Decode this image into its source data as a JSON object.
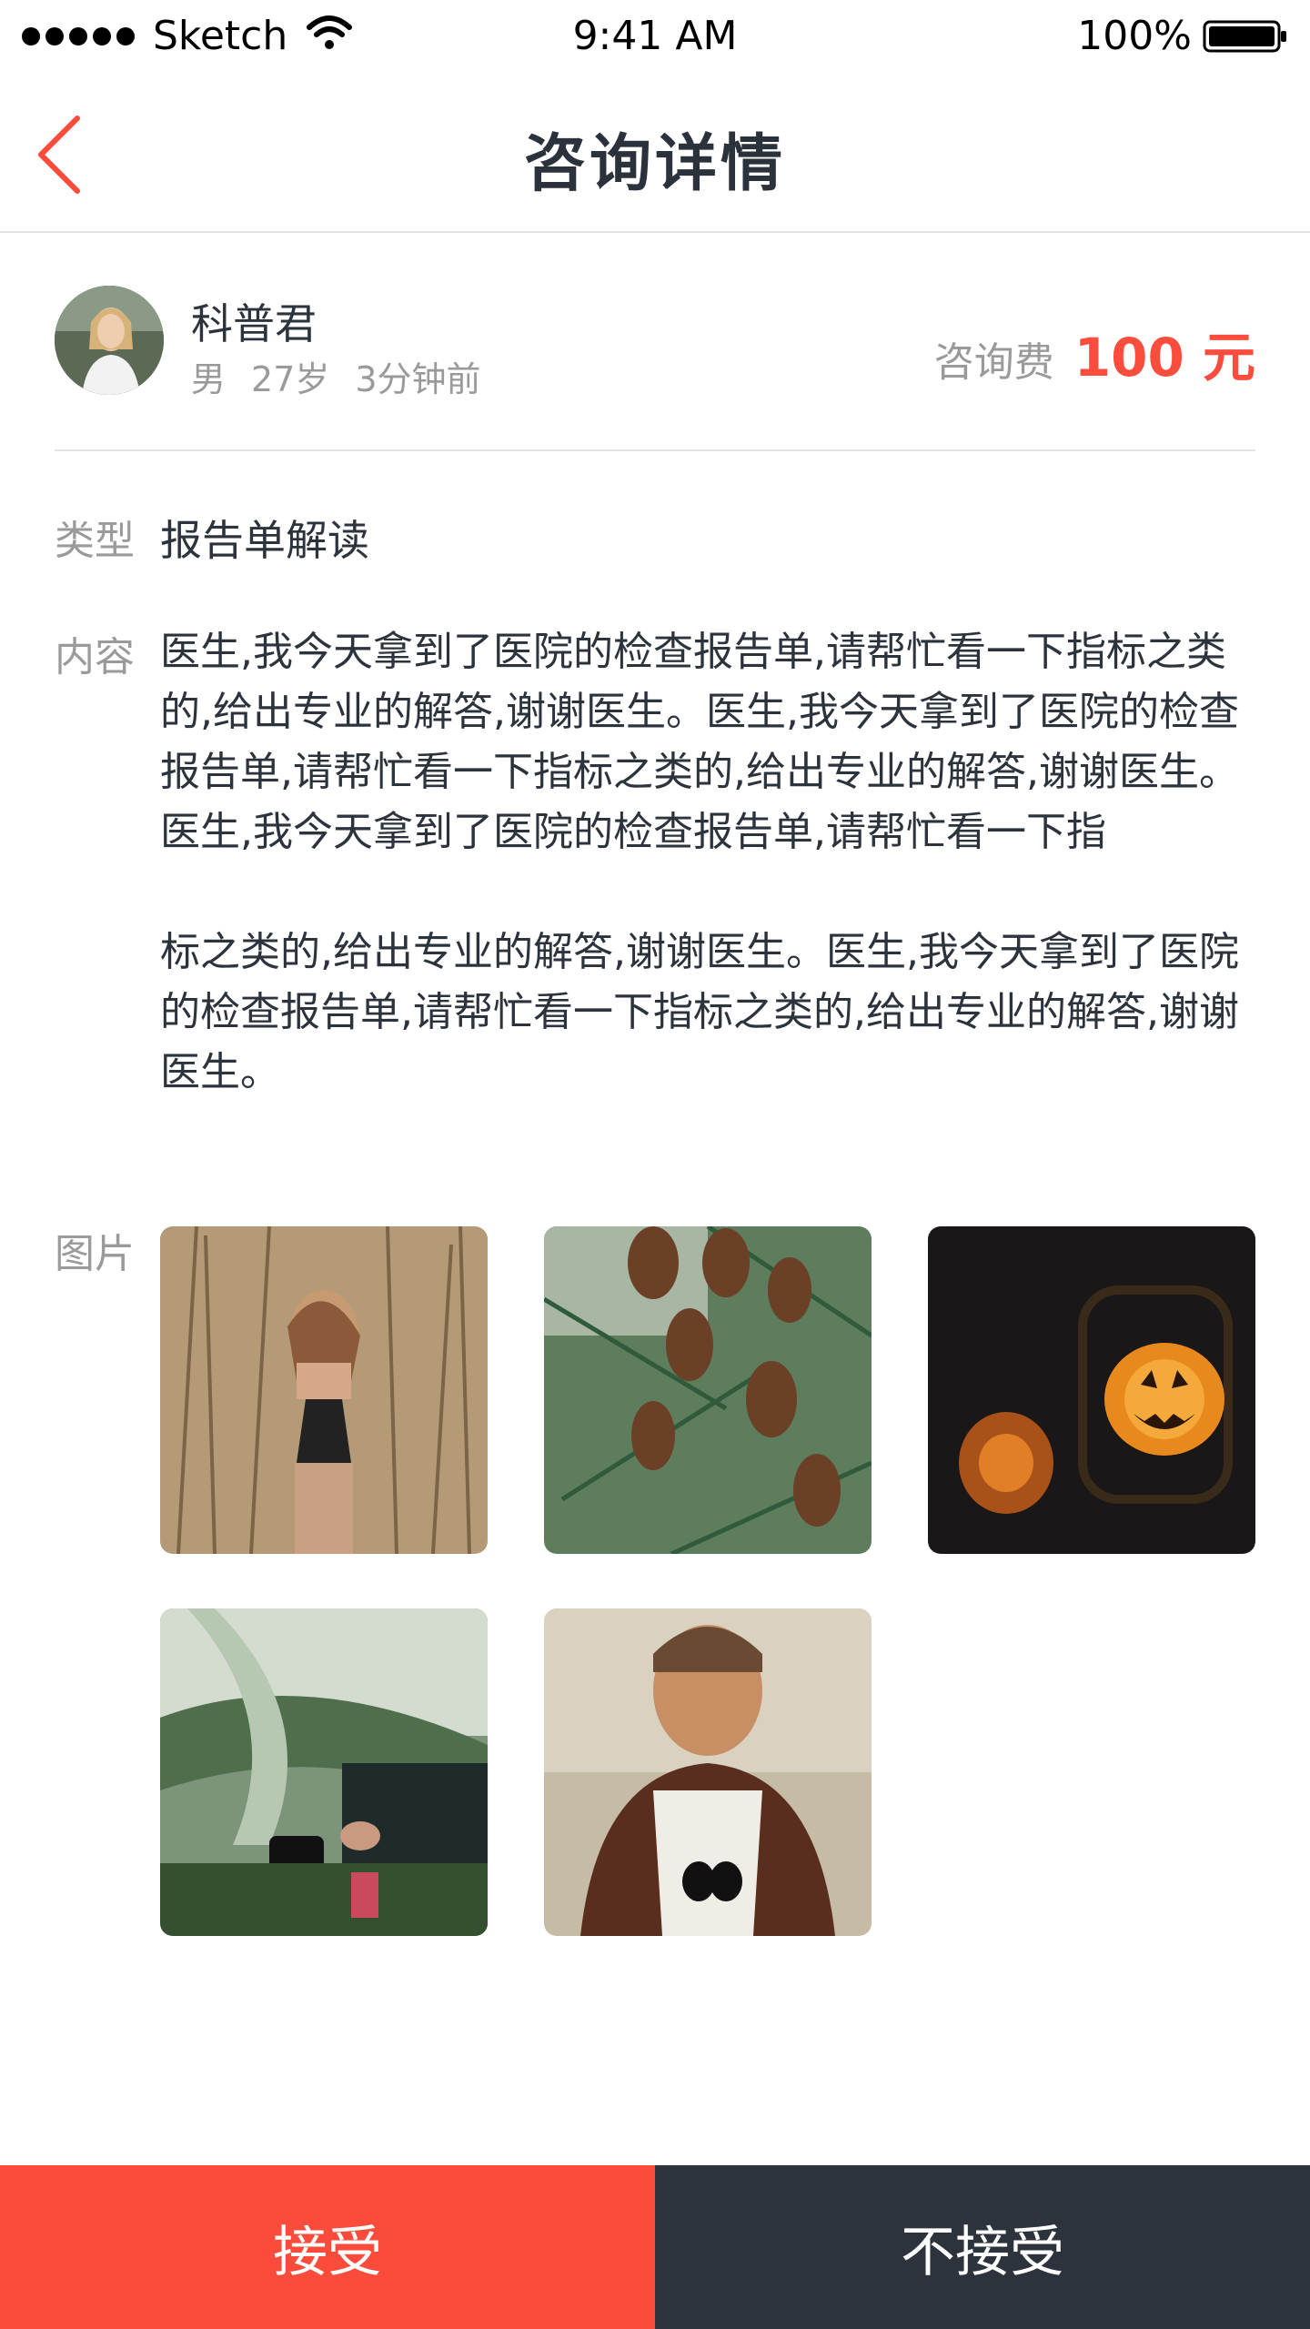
{
  "status_bar": {
    "carrier": "Sketch",
    "time": "9:41 AM",
    "battery": "100%"
  },
  "nav": {
    "title": "咨询详情"
  },
  "user": {
    "name": "科普君",
    "gender": "男",
    "age": "27岁",
    "posted": "3分钟前"
  },
  "fee": {
    "label": "咨询费",
    "amount": "100 元"
  },
  "type": {
    "label": "类型",
    "value": "报告单解读"
  },
  "content": {
    "label": "内容",
    "paragraphs": [
      "医生,我今天拿到了医院的检查报告单,请帮忙看一下指标之类的,给出专业的解答,谢谢医生。医生,我今天拿到了医院的检查报告单,请帮忙看一下指标之类的,给出专业的解答,谢谢医生。医生,我今天拿到了医院的检查报告单,请帮忙看一下指",
      "标之类的,给出专业的解答,谢谢医生。医生,我今天拿到了医院的检查报告单,请帮忙看一下指标之类的,给出专业的解答,谢谢医生。"
    ]
  },
  "images": {
    "label": "图片"
  },
  "actions": {
    "accept": "接受",
    "reject": "不接受"
  },
  "colors": {
    "accent": "#fb4b3a",
    "dark": "#2c333d",
    "muted": "#9a9a9a"
  }
}
